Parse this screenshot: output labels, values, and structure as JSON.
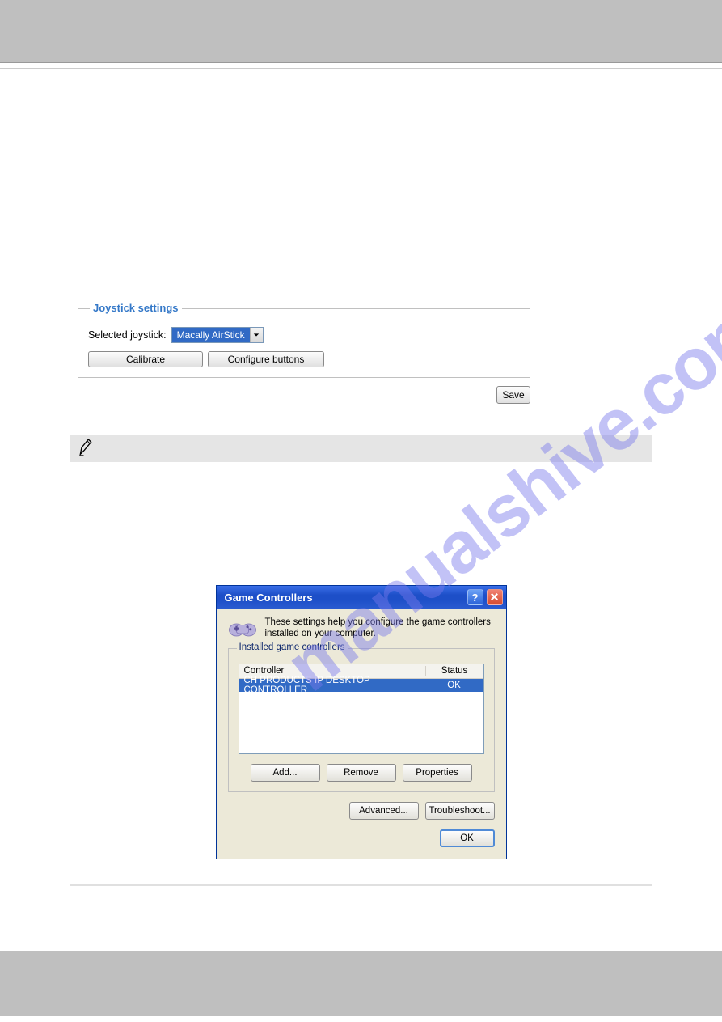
{
  "watermark": "manualshive.com",
  "joystick_panel": {
    "legend": "Joystick settings",
    "selected_label": "Selected joystick:",
    "selected_value": "Macally AirStick",
    "calibrate": "Calibrate",
    "configure": "Configure buttons",
    "save": "Save"
  },
  "dialog": {
    "title": "Game Controllers",
    "help_char": "?",
    "desc": "These settings help you configure the game controllers installed on your computer.",
    "group_legend": "Installed game controllers",
    "col_controller": "Controller",
    "col_status": "Status",
    "row_controller": "CH PRODUCTS IP DESKTOP CONTROLLER",
    "row_status": "OK",
    "add": "Add...",
    "remove": "Remove",
    "properties": "Properties",
    "advanced": "Advanced...",
    "troubleshoot": "Troubleshoot...",
    "ok": "OK"
  }
}
